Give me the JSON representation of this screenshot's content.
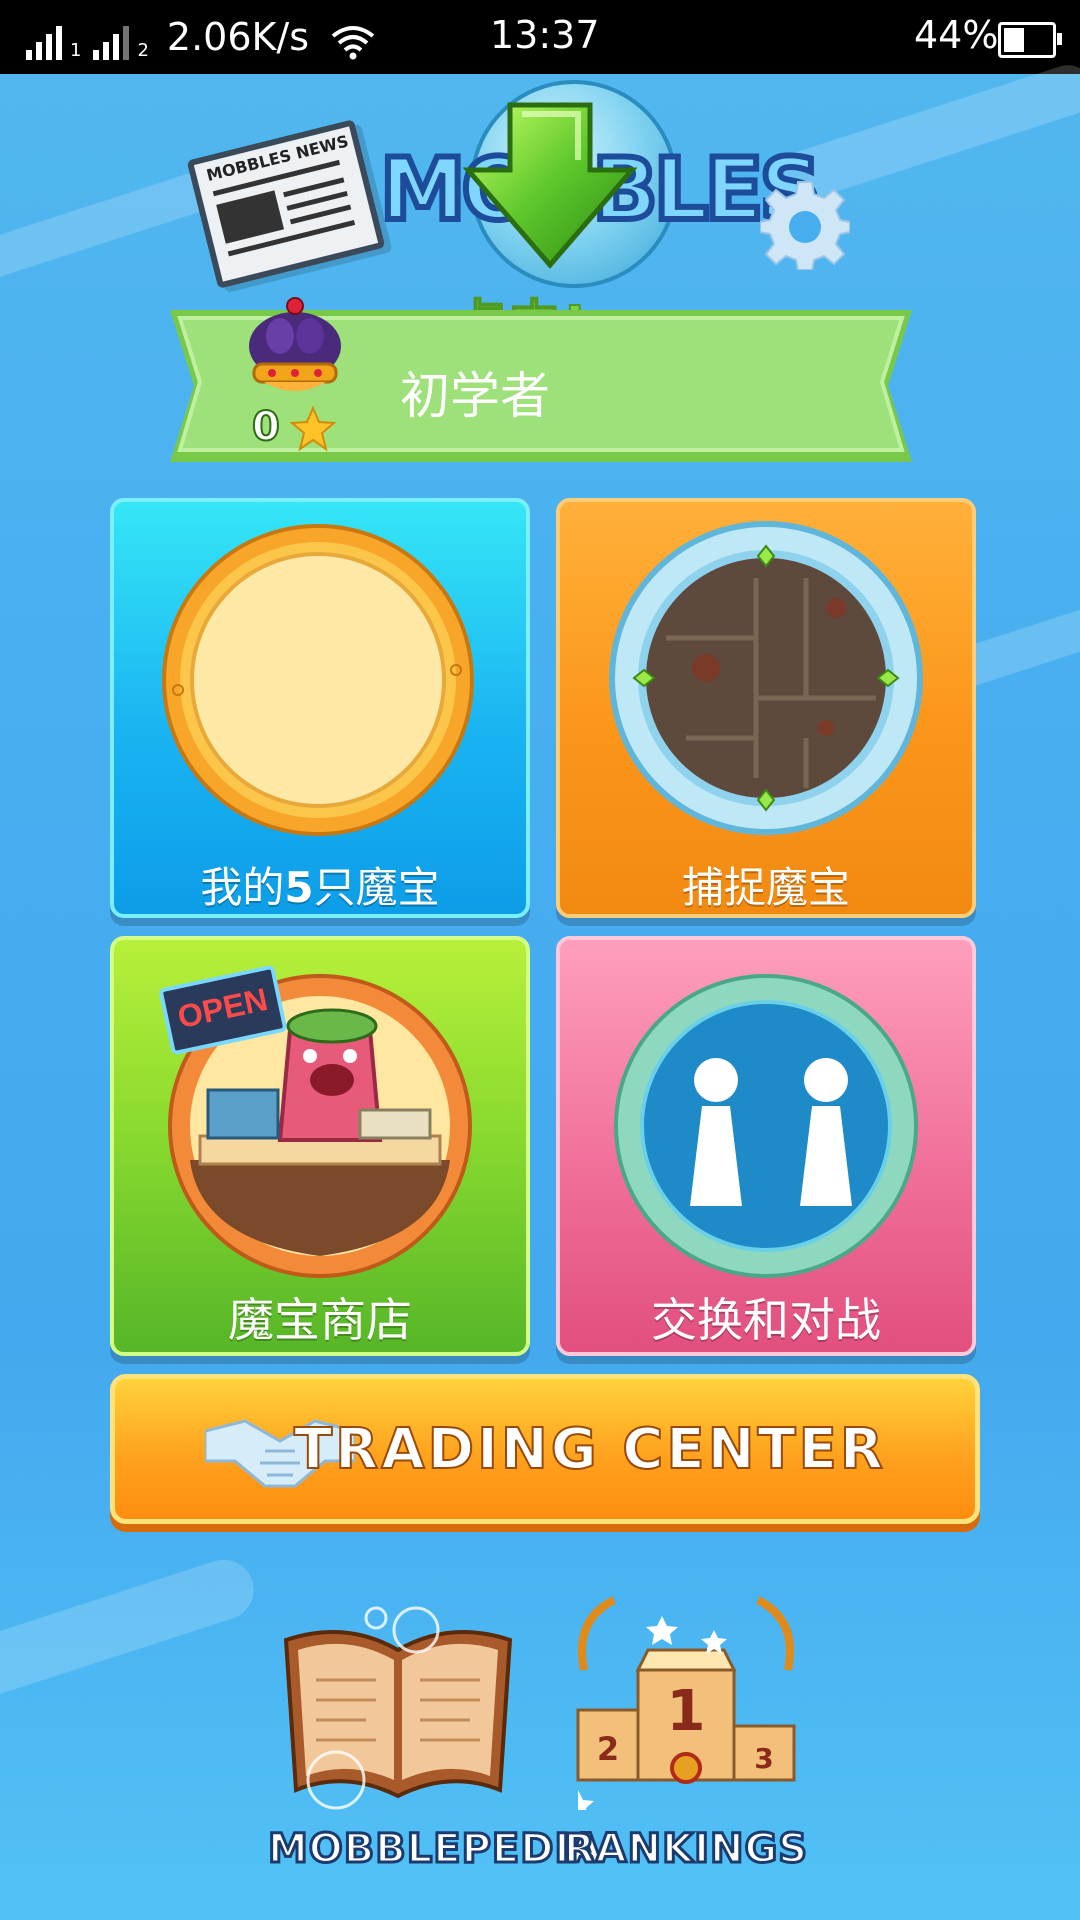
{
  "status_bar": {
    "sim1": "1",
    "sim2": "2",
    "network_speed": "2.06K/s",
    "time": "13:37",
    "battery_percent": "44%",
    "battery_level": 0.44
  },
  "header": {
    "news_icon_text": "MOBBLES NEWS",
    "logo_text": "MOBBLES",
    "tap_prompt": "点击!"
  },
  "player": {
    "rank_name": "初学者",
    "stars": "0"
  },
  "tiles": {
    "my_mobbles": {
      "label_prefix": "我的",
      "count": "5",
      "label_suffix": "只魔宝"
    },
    "catch": {
      "label": "捕捉魔宝"
    },
    "shop": {
      "label": "魔宝商店",
      "sign": "OPEN"
    },
    "battle": {
      "label": "交换和对战"
    }
  },
  "trading_center": {
    "label": "TRADING CENTER"
  },
  "bottom": {
    "mobblepedia": "MOBBLEPEDIA",
    "rankings": "RANKINGS"
  },
  "colors": {
    "background": "#47aef0",
    "tile_blue": "#1ab4f2",
    "tile_orange": "#fb961a",
    "tile_green": "#86d82e",
    "tile_pink": "#f0709a",
    "banner_green": "#9be07a"
  }
}
